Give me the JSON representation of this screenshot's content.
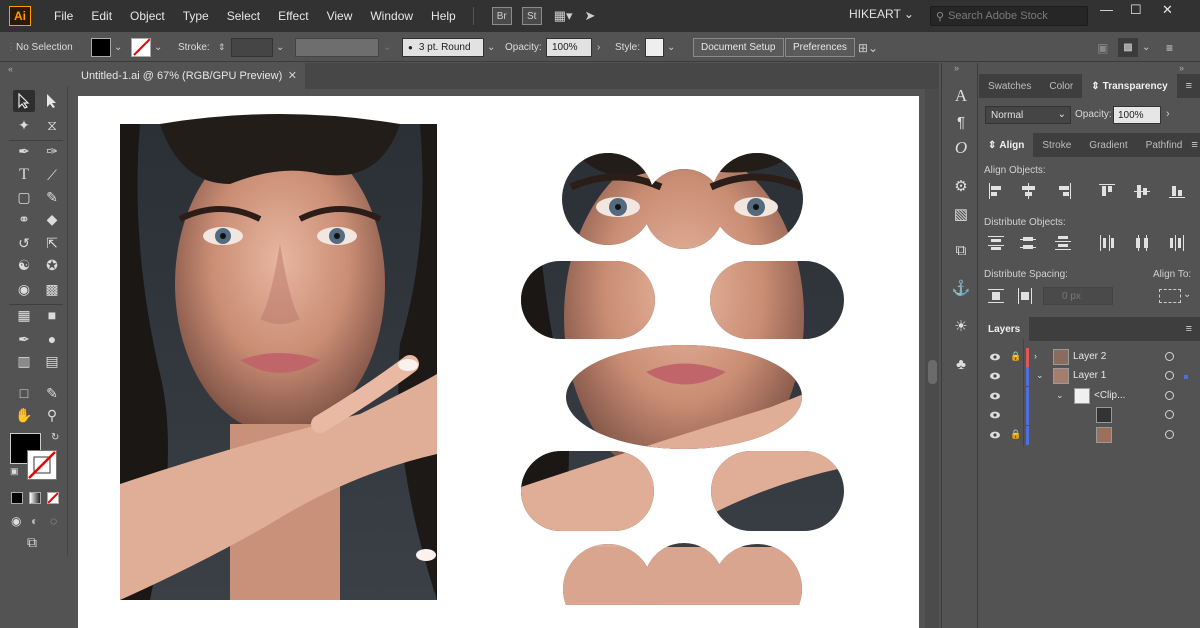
{
  "app": {
    "logo": "Ai",
    "menu": [
      "File",
      "Edit",
      "Object",
      "Type",
      "Select",
      "Effect",
      "View",
      "Window",
      "Help"
    ],
    "bridge": "Br",
    "stock": "St",
    "workspace": "HIKEART",
    "search_placeholder": "Search Adobe Stock"
  },
  "control": {
    "selection": "No Selection",
    "stroke_label": "Stroke:",
    "brush": "3 pt. Round",
    "opacity_label": "Opacity:",
    "opacity": "100%",
    "style_label": "Style:",
    "document_setup": "Document Setup",
    "preferences": "Preferences"
  },
  "document": {
    "tab_title": "Untitled-1.ai @ 67% (RGB/GPU Preview)"
  },
  "panels": {
    "top_tabs": [
      "Swatches",
      "Color",
      "Transparency"
    ],
    "blend_mode": "Normal",
    "opacity_label": "Opacity:",
    "opacity": "100%",
    "align_tabs": [
      "Align",
      "Stroke",
      "Gradient",
      "Pathfind"
    ],
    "align_objects": "Align Objects:",
    "distribute_objects": "Distribute Objects:",
    "distribute_spacing": "Distribute Spacing:",
    "align_to": "Align To:",
    "spacing_value": "0 px",
    "layers_tab": "Layers",
    "layers": [
      {
        "name": "Layer 2",
        "bar_color": "#e25656"
      },
      {
        "name": "Layer 1",
        "bar_color": "#4f6fe0"
      },
      {
        "name": "<Clip...",
        "bar_color": "#4f6fe0"
      },
      {
        "name": "",
        "bar_color": "#4f6fe0"
      },
      {
        "name": "",
        "bar_color": "#4f6fe0"
      }
    ]
  },
  "colors": {
    "accent_ai": "#ff9a00",
    "chrome_dark": "#323232",
    "chrome": "#535353"
  }
}
